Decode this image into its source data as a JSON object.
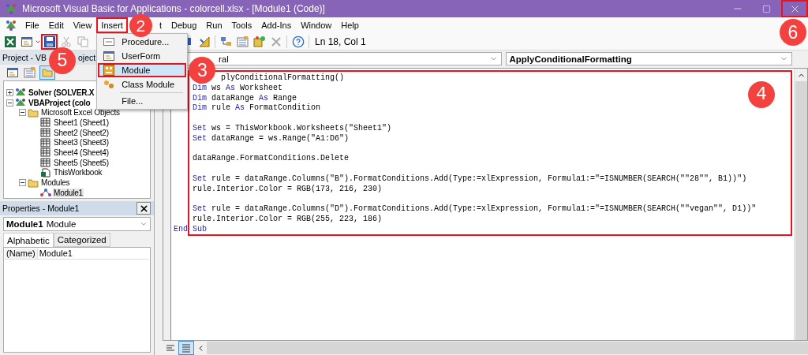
{
  "window": {
    "title": "Microsoft Visual Basic for Applications - colorcell.xlsx - [Module1 (Code)]",
    "close_button": {
      "highlighted": true,
      "callout": "6"
    }
  },
  "menu": [
    {
      "label": "File",
      "highlighted": false
    },
    {
      "label": "Edit",
      "highlighted": false
    },
    {
      "label": "View",
      "highlighted": false
    },
    {
      "label": "Insert",
      "highlighted": true,
      "callout": "2",
      "dropdown": [
        {
          "label": "Procedure...",
          "kind": "procedure",
          "selected": false,
          "highlighted": false
        },
        {
          "label": "UserForm",
          "kind": "userform",
          "selected": false,
          "highlighted": false
        },
        {
          "label": "Module",
          "kind": "module",
          "selected": true,
          "highlighted": true,
          "callout": "3"
        },
        {
          "label": "Class Module",
          "kind": "class",
          "selected": false,
          "highlighted": false
        },
        {
          "label": "File...",
          "kind": "file",
          "selected": false,
          "highlighted": false,
          "divider_above": true
        }
      ]
    },
    {
      "label": "t",
      "highlighted": false
    },
    {
      "label": "Debug",
      "highlighted": false
    },
    {
      "label": "Run",
      "highlighted": false
    },
    {
      "label": "Tools",
      "highlighted": false
    },
    {
      "label": "Add-Ins",
      "highlighted": false
    },
    {
      "label": "Window",
      "highlighted": false
    },
    {
      "label": "Help",
      "highlighted": false
    }
  ],
  "toolbar": {
    "save_button": {
      "highlighted": true,
      "callout": "5"
    },
    "position": "Ln 18, Col 1"
  },
  "project_explorer": {
    "title_parts": [
      "Project - VB",
      "oject"
    ],
    "tree": [
      {
        "label": "Solver (SOLVER.X",
        "kind": "project",
        "expanded": false,
        "selected": false
      },
      {
        "label": "VBAProject (colo",
        "kind": "project",
        "expanded": true,
        "selected": false,
        "children": [
          {
            "label": "Microsoft Excel Objects",
            "kind": "folder",
            "expanded": true,
            "selected": false,
            "children": [
              {
                "label": "Sheet1 (Sheet1)",
                "kind": "sheet",
                "selected": false
              },
              {
                "label": "Sheet2 (Sheet2)",
                "kind": "sheet",
                "selected": false
              },
              {
                "label": "Sheet3 (Sheet3)",
                "kind": "sheet",
                "selected": false
              },
              {
                "label": "Sheet4 (Sheet4)",
                "kind": "sheet",
                "selected": false
              },
              {
                "label": "Sheet5 (Sheet5)",
                "kind": "sheet",
                "selected": false
              },
              {
                "label": "ThisWorkbook",
                "kind": "workbook",
                "selected": false
              }
            ]
          },
          {
            "label": "Modules",
            "kind": "folder",
            "expanded": true,
            "selected": false,
            "children": [
              {
                "label": "Module1",
                "kind": "module",
                "selected": true
              }
            ]
          }
        ]
      }
    ]
  },
  "properties": {
    "title": "Properties - Module1",
    "object_name": "Module1",
    "object_type": "Module",
    "tabs": [
      {
        "label": "Alphabetic",
        "selected": true
      },
      {
        "label": "Categorized",
        "selected": false
      }
    ],
    "rows": [
      {
        "name": "(Name)",
        "value": "Module1"
      }
    ]
  },
  "code_window": {
    "object_dropdown": "ral",
    "procedure_dropdown": "ApplyConditionalFormatting",
    "highlighted": true,
    "callout": "4",
    "lines": [
      {
        "kind": "partial",
        "indented": true,
        "tokens": [
          {
            "text": "plyConditionalFormatting()",
            "kind": "plain"
          }
        ]
      },
      {
        "kind": "code",
        "indented": true,
        "tokens": [
          {
            "text": "Dim",
            "kind": "keyword"
          },
          {
            "text": " ws ",
            "kind": "plain"
          },
          {
            "text": "As",
            "kind": "keyword"
          },
          {
            "text": " Worksheet",
            "kind": "plain"
          }
        ]
      },
      {
        "kind": "code",
        "indented": true,
        "tokens": [
          {
            "text": "Dim",
            "kind": "keyword"
          },
          {
            "text": " dataRange ",
            "kind": "plain"
          },
          {
            "text": "As",
            "kind": "keyword"
          },
          {
            "text": " Range",
            "kind": "plain"
          }
        ]
      },
      {
        "kind": "code",
        "indented": true,
        "tokens": [
          {
            "text": "Dim",
            "kind": "keyword"
          },
          {
            "text": " rule ",
            "kind": "plain"
          },
          {
            "text": "As",
            "kind": "keyword"
          },
          {
            "text": " FormatCondition",
            "kind": "plain"
          }
        ]
      },
      {
        "kind": "blank"
      },
      {
        "kind": "code",
        "indented": true,
        "tokens": [
          {
            "text": "Set",
            "kind": "keyword"
          },
          {
            "text": " ws = ThisWorkbook.Worksheets(\"Sheet1\")",
            "kind": "plain"
          }
        ]
      },
      {
        "kind": "code",
        "indented": true,
        "tokens": [
          {
            "text": "Set",
            "kind": "keyword"
          },
          {
            "text": " dataRange = ws.Range(\"A1:D6\")",
            "kind": "plain"
          }
        ]
      },
      {
        "kind": "blank"
      },
      {
        "kind": "code",
        "indented": true,
        "tokens": [
          {
            "text": "dataRange.FormatConditions.Delete",
            "kind": "plain"
          }
        ]
      },
      {
        "kind": "blank"
      },
      {
        "kind": "code",
        "indented": true,
        "tokens": [
          {
            "text": "Set",
            "kind": "keyword"
          },
          {
            "text": " rule = dataRange.Columns(\"B\").FormatConditions.Add(Type:=xlExpression, Formula1:=\"=ISNUMBER(SEARCH(\"\"28\"\", B1))\")",
            "kind": "plain"
          }
        ]
      },
      {
        "kind": "code",
        "indented": true,
        "tokens": [
          {
            "text": "rule.Interior.Color = RGB(173, 216, 230)",
            "kind": "plain"
          }
        ]
      },
      {
        "kind": "blank"
      },
      {
        "kind": "code",
        "indented": true,
        "tokens": [
          {
            "text": "Set",
            "kind": "keyword"
          },
          {
            "text": " rule = dataRange.Columns(\"D\").FormatConditions.Add(Type:=xlExpression, Formula1:=\"=ISNUMBER(SEARCH(\"\"vegan\"\", D1))\"",
            "kind": "plain"
          }
        ]
      },
      {
        "kind": "code",
        "indented": true,
        "tokens": [
          {
            "text": "rule.Interior.Color = RGB(255, 223, 186)",
            "kind": "plain"
          }
        ]
      },
      {
        "kind": "code",
        "indented": false,
        "tokens": [
          {
            "text": "End",
            "kind": "keyword"
          },
          {
            "text": " Sub",
            "kind": "keyword"
          }
        ]
      }
    ]
  }
}
